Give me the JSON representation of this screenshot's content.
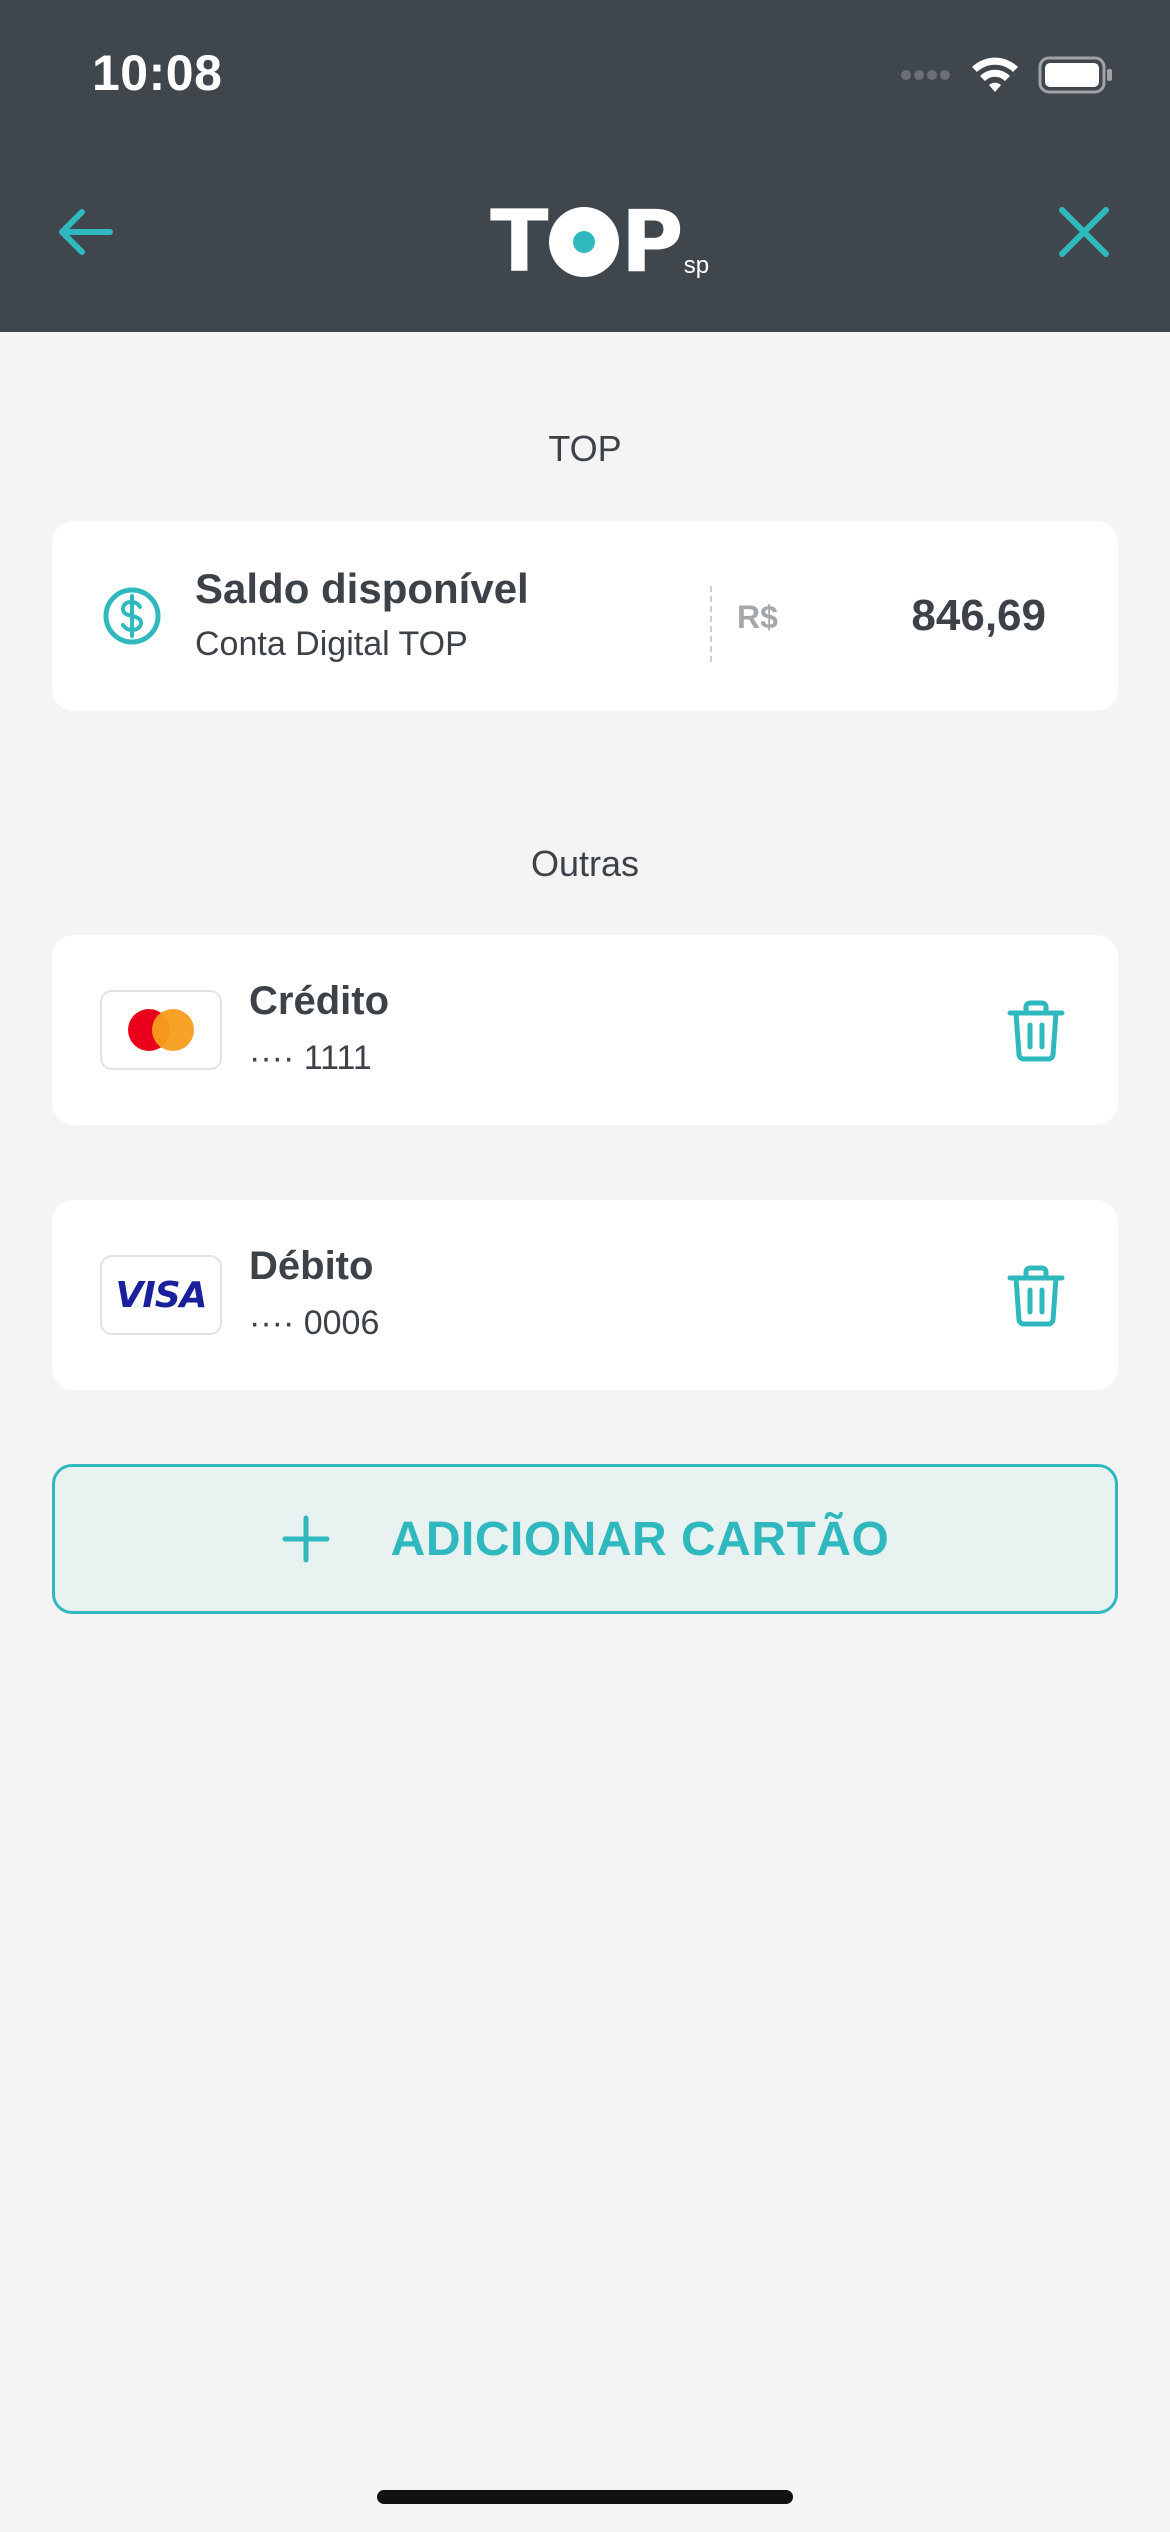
{
  "status_bar": {
    "time": "10:08"
  },
  "header": {
    "logo_text_left": "T",
    "logo_text_right": "P",
    "logo_suffix": "sp",
    "back_icon": "arrow-left-icon",
    "close_icon": "close-icon"
  },
  "sections": {
    "top_label": "TOP",
    "other_label": "Outras"
  },
  "balance": {
    "title": "Saldo disponível",
    "subtitle": "Conta Digital TOP",
    "currency": "R$",
    "amount": "846,69",
    "icon": "dollar-circle-icon"
  },
  "cards": [
    {
      "brand": "Mastercard",
      "type": "Crédito",
      "number": "···· 1111",
      "brand_icon": "mastercard-icon"
    },
    {
      "brand": "Visa",
      "brand_label": "VISA",
      "type": "Débito",
      "number": "···· 0006",
      "brand_icon": "visa-icon"
    }
  ],
  "add_card": {
    "label": "ADICIONAR CARTÃO",
    "icon": "plus-icon"
  },
  "colors": {
    "header_bg": "#3f464c",
    "accent": "#2fb9bf",
    "page_bg": "#f4f4f4",
    "text": "#3d4249"
  }
}
